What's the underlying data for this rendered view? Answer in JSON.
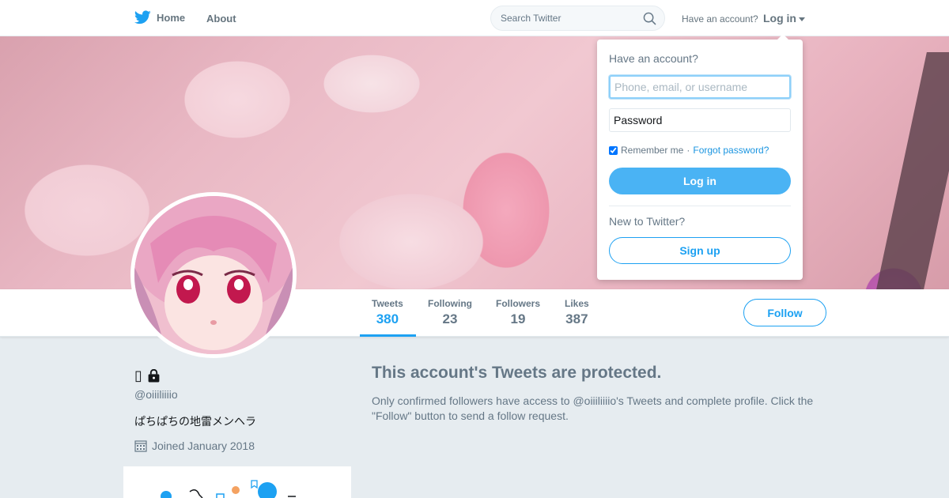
{
  "nav": {
    "home_label": "Home",
    "about_label": "About",
    "search_placeholder": "Search Twitter",
    "have_account_text": "Have an account?",
    "login_label": "Log in"
  },
  "login_dropdown": {
    "have_account": "Have an account?",
    "username_placeholder": "Phone, email, or username",
    "password_placeholder": "Password",
    "remember_label": "Remember me",
    "separator": "·",
    "forgot_label": "Forgot password?",
    "remember_checked": true,
    "login_button": "Log in",
    "new_text": "New to Twitter?",
    "signup_button": "Sign up"
  },
  "stats": [
    {
      "label": "Tweets",
      "value": "380"
    },
    {
      "label": "Following",
      "value": "23"
    },
    {
      "label": "Followers",
      "value": "19"
    },
    {
      "label": "Likes",
      "value": "387"
    }
  ],
  "follow_button": "Follow",
  "profile": {
    "name_glyph": "▯",
    "lock_icon": "lock-icon",
    "handle": "@oiiiliiiio",
    "bio": "ぱちぱちの地雷メンヘラ",
    "joined": "Joined January 2018"
  },
  "protected": {
    "title": "This account's Tweets are protected.",
    "body": "Only confirmed followers have access to @oiiiliiiio's Tweets and complete profile. Click the \"Follow\" button to send a follow request."
  },
  "colors": {
    "accent": "#1da1f2",
    "login_button_bg": "#4ab3f4",
    "page_bg": "#e6ecf0"
  }
}
